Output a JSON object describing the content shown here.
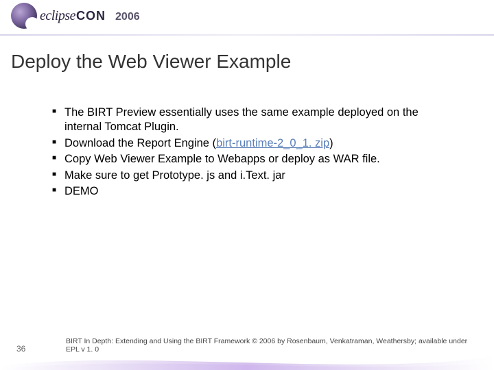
{
  "header": {
    "brand_part1": "eclipse",
    "brand_part2": "CON",
    "year": "2006"
  },
  "title": "Deploy the Web Viewer Example",
  "bullets": [
    {
      "text": "The BIRT Preview essentially uses the same example deployed on the internal Tomcat Plugin."
    },
    {
      "prefix": "Download the Report Engine (",
      "link": "birt-runtime-2_0_1. zip",
      "suffix": ")"
    },
    {
      "text": "Copy Web Viewer Example to Webapps or deploy as WAR file."
    },
    {
      "text": "Make sure to get Prototype. js and i.Text. jar"
    },
    {
      "text": "DEMO"
    }
  ],
  "footer": {
    "slide_number": "36",
    "text": "BIRT In Depth: Extending and Using the BIRT Framework © 2006 by Rosenbaum, Venkatraman, Weathersby; available under EPL v 1. 0"
  }
}
